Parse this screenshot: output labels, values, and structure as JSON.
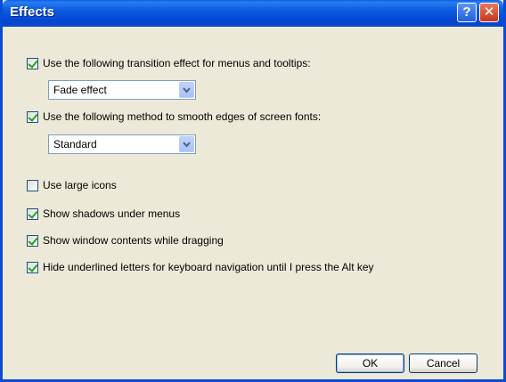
{
  "window": {
    "title": "Effects",
    "help_glyph": "?",
    "close_glyph": "✕"
  },
  "options": [
    {
      "label": "Use the following transition effect for menus and tooltips:",
      "checked": true
    },
    {
      "label": "Use the following method to smooth edges of screen fonts:",
      "checked": true
    },
    {
      "label": "Use large icons",
      "checked": false
    },
    {
      "label": "Show shadows under menus",
      "checked": true
    },
    {
      "label": "Show window contents while dragging",
      "checked": true
    },
    {
      "label": "Hide underlined letters for keyboard navigation until I press the Alt key",
      "checked": true
    }
  ],
  "combos": {
    "transition": "Fade effect",
    "smoothing": "Standard"
  },
  "buttons": {
    "ok": "OK",
    "cancel": "Cancel"
  }
}
